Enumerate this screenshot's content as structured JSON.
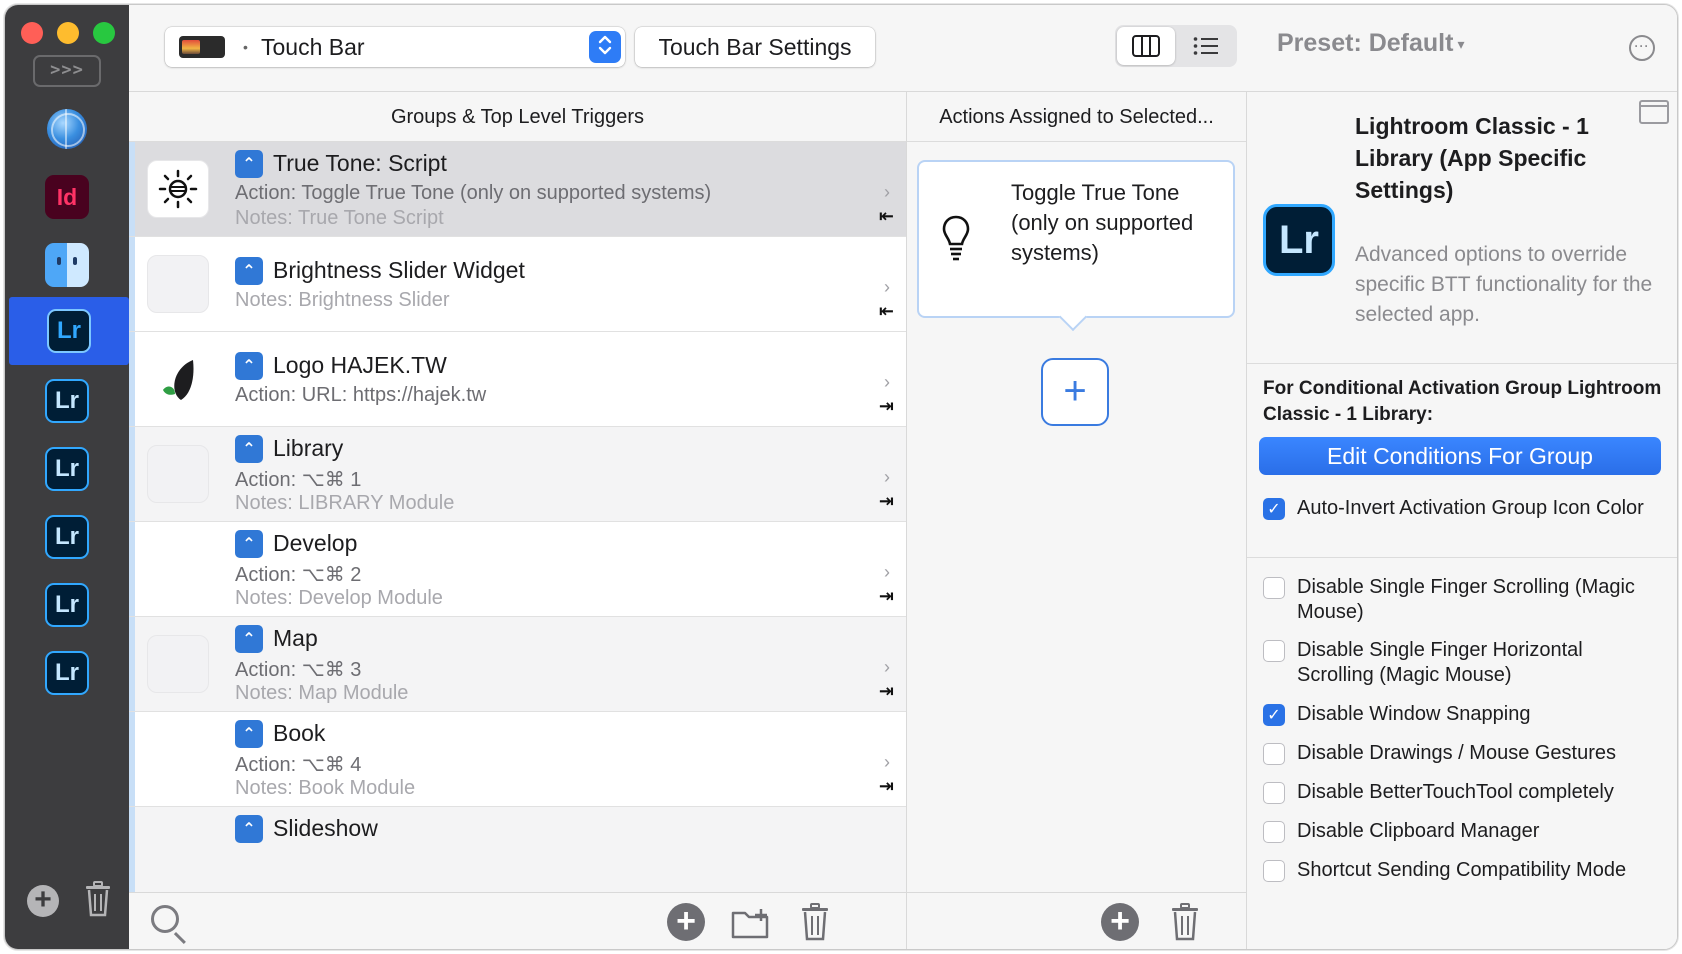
{
  "sidebar": {
    "expand_label": ">>>",
    "apps": [
      {
        "name": "globe",
        "label": ""
      },
      {
        "name": "indesign",
        "label": "Id"
      },
      {
        "name": "finder",
        "label": ""
      },
      {
        "name": "lightroom",
        "label": "Lr"
      },
      {
        "name": "lightroom",
        "label": "Lr"
      },
      {
        "name": "lightroom",
        "label": "Lr"
      },
      {
        "name": "lightroom",
        "label": "Lr"
      },
      {
        "name": "lightroom",
        "label": "Lr"
      },
      {
        "name": "lightroom",
        "label": "Lr"
      }
    ],
    "selected_index": 3
  },
  "toolbar": {
    "device_dot": "•",
    "device_label": "Touch Bar",
    "settings_label": "Touch Bar Settings",
    "preset_label": "Preset: Default",
    "preset_caret": "▾"
  },
  "groups": {
    "header": "Groups & Top Level Triggers",
    "rows": [
      {
        "title": "True Tone: Script",
        "action": "Action: Toggle True Tone (only on supported systems)",
        "notes": "Notes: True Tone Script",
        "chevron": "›",
        "direction": "⇤"
      },
      {
        "title": "Brightness Slider Widget",
        "action": "",
        "notes": "Notes: Brightness Slider",
        "chevron": "›",
        "direction": "⇤"
      },
      {
        "title": "Logo HAJEK.TW",
        "action": "Action: URL: https://hajek.tw",
        "notes": "",
        "chevron": "›",
        "direction": "⇥"
      },
      {
        "title": "Library",
        "action": "Action: ⌥⌘ 1",
        "notes": "Notes: LIBRARY Module",
        "chevron": "›",
        "direction": "⇥"
      },
      {
        "title": "Develop",
        "action": "Action: ⌥⌘ 2",
        "notes": "Notes: Develop Module",
        "chevron": "›",
        "direction": "⇥"
      },
      {
        "title": "Map",
        "action": "Action: ⌥⌘ 3",
        "notes": "Notes: Map Module",
        "chevron": "›",
        "direction": "⇥"
      },
      {
        "title": "Book",
        "action": "Action: ⌥⌘ 4",
        "notes": "Notes: Book Module",
        "chevron": "›",
        "direction": "⇥"
      },
      {
        "title": "Slideshow",
        "action": "",
        "notes": "",
        "chevron": "",
        "direction": ""
      }
    ],
    "badge_glyph": "⌃"
  },
  "actions": {
    "header": "Actions Assigned to Selected...",
    "card_text": "Toggle True Tone (only on supported systems)",
    "add_glyph": "+"
  },
  "inspector": {
    "title": "Lightroom Classic - 1 Library (App Specific Settings)",
    "description": "Advanced options to override specific BTT functionality for the selected app.",
    "app_icon_label": "Lr",
    "group_label": "For Conditional Activation Group Lightroom Classic - 1 Library:",
    "edit_button": "Edit Conditions For Group",
    "options": [
      {
        "label": "Auto-Invert Activation Group Icon Color",
        "checked": true
      },
      {
        "label": "Disable Single Finger Scrolling (Magic Mouse)",
        "checked": false
      },
      {
        "label": "Disable Single Finger Horizontal Scrolling (Magic Mouse)",
        "checked": false
      },
      {
        "label": "Disable Window Snapping",
        "checked": true
      },
      {
        "label": "Disable Drawings / Mouse Gestures",
        "checked": false
      },
      {
        "label": "Disable BetterTouchTool completely",
        "checked": false
      },
      {
        "label": "Disable Clipboard Manager",
        "checked": false
      },
      {
        "label": "Shortcut Sending Compatibility Mode",
        "checked": false
      }
    ],
    "check_glyph": "✓"
  },
  "colors": {
    "accent": "#2a72e6",
    "selected_app": "#2a5ee8",
    "sidebar_bg": "#3d3d3f"
  }
}
